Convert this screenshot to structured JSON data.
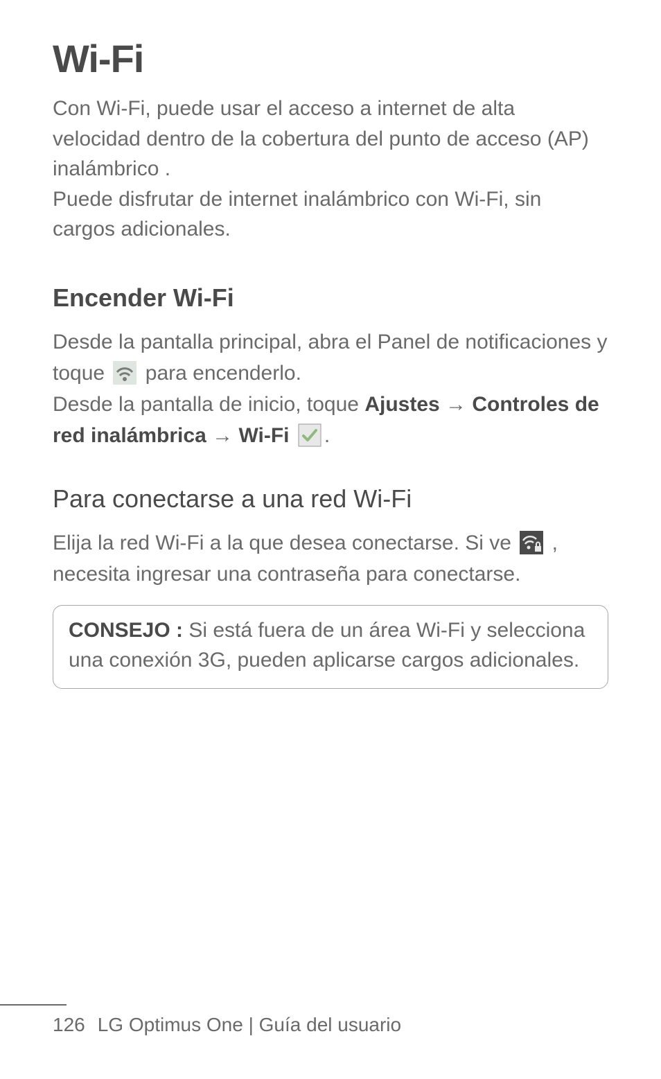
{
  "title": "Wi-Fi",
  "intro": {
    "p1": "Con Wi-Fi, puede usar el acceso a internet de alta velocidad dentro de la cobertura del punto de acceso (AP) inalámbrico .",
    "p2": "Puede disfrutar de internet inalámbrico con Wi-Fi, sin cargos adicionales."
  },
  "section1": {
    "heading": "Encender Wi-Fi",
    "line1a": "Desde la pantalla principal, abra el Panel de notificaciones y toque ",
    "line1b": " para encenderlo.",
    "line2a": "Desde la pantalla de inicio, toque ",
    "bold_ajustes": "Ajustes",
    "arrow1": " → ",
    "bold_controles": "Controles de red inalámbrica",
    "arrow2": " → ",
    "bold_wifi": "Wi-Fi ",
    "period": "."
  },
  "section2": {
    "heading": "Para conectarse a una red Wi-Fi",
    "line1a": "Elija la red Wi-Fi a la que desea conectarse. Si ve ",
    "line1b": " , necesita ingresar una contraseña para conectarse."
  },
  "tip": {
    "label": "CONSEJO :",
    "text": " Si está fuera de un área Wi-Fi y selecciona una conexión 3G, pueden aplicarse cargos adicionales."
  },
  "footer": {
    "page": "126",
    "label": "LG Optimus One | Guía del usuario"
  }
}
